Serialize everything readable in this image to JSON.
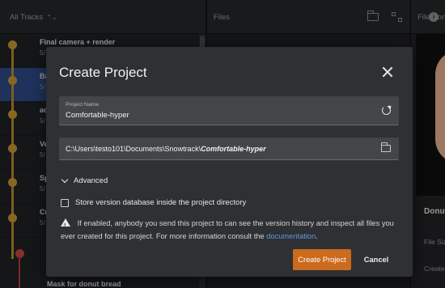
{
  "header": {
    "tracks_label": "All Tracks",
    "sort_glyph": "⌃⌄",
    "info_glyph": "i",
    "files_label": "Files",
    "file_content_label": "File Content"
  },
  "tracks": [
    {
      "title": "Final camera + render",
      "sub": "5/",
      "selected": false
    },
    {
      "title": "Ba",
      "sub": "5/",
      "selected": true
    },
    {
      "title": "ac",
      "sub": "5/",
      "selected": false
    },
    {
      "title": "Ve",
      "sub": "5/",
      "selected": false
    },
    {
      "title": "Sp",
      "sub": "5/",
      "selected": false
    },
    {
      "title": "Cr",
      "sub": "5/",
      "selected": false
    },
    {
      "title": "Mask for donut bread",
      "sub": "",
      "selected": false
    }
  ],
  "file_content": {
    "title": "Donut",
    "size_label": "File Size",
    "created_label": "Created"
  },
  "dialog": {
    "title": "Create Project",
    "project_name_label": "Project Name",
    "project_name_value": "Comfortable-hyper",
    "path_prefix": "C:\\Users\\testo101\\Documents\\Snowtrack\\",
    "path_name": "Comfortable-hyper",
    "advanced_label": "Advanced",
    "checkbox_label": "Store version database inside the project directory",
    "warning_text": "If enabled, anybody you send this project to can see the version history and inspect all files you ever created for this project. For more information consult the",
    "warning_link": "documentation",
    "warning_end": ".",
    "create_button": "Create Project",
    "cancel_button": "Cancel"
  },
  "colors": {
    "accent": "#cc6a1e",
    "selection": "#2e4a86",
    "graph_gold": "#c99a32",
    "graph_red": "#c9473f",
    "link": "#5c9ae0"
  },
  "icons": [
    "info-icon",
    "folder-icon",
    "tree-view-icon",
    "close-icon",
    "refresh-icon",
    "chevron-down-icon",
    "warning-icon"
  ]
}
